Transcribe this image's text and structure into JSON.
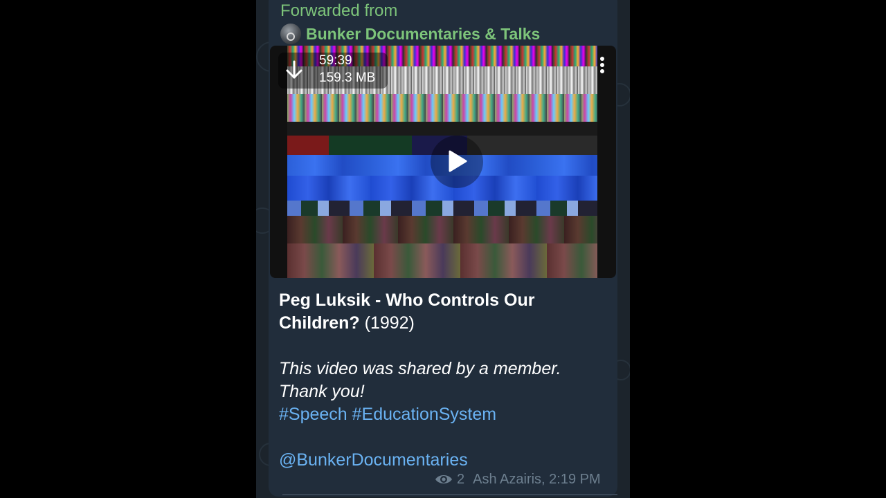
{
  "message": {
    "forwarded_label": "Forwarded from",
    "channel_name": "Bunker Documentaries & Talks",
    "video": {
      "duration": "59:39",
      "file_size": "159.3 MB"
    },
    "caption": {
      "title_bold": "Peg Luksik - Who Controls Our Children?",
      "title_year": " (1992)",
      "italic_line_1": "This video was shared by a member.",
      "italic_line_2": "Thank you!",
      "hashtag_1": "#Speech",
      "hashtag_2": "#EducationSystem",
      "mention": "@BunkerDocumentaries"
    },
    "footer": {
      "views": "2",
      "author_time": "Ash Azairis, 2:19 PM"
    }
  },
  "colors": {
    "accent_green": "#7dc47a",
    "link_blue": "#6ab2f2",
    "bubble_bg": "#212d3b",
    "chat_bg": "#1c242c",
    "meta_gray": "#6d7f8f"
  },
  "icons": {
    "download": "download-arrow-icon",
    "menu": "more-vertical-icon",
    "play": "play-icon",
    "views": "eye-icon",
    "avatar": "channel-avatar"
  }
}
